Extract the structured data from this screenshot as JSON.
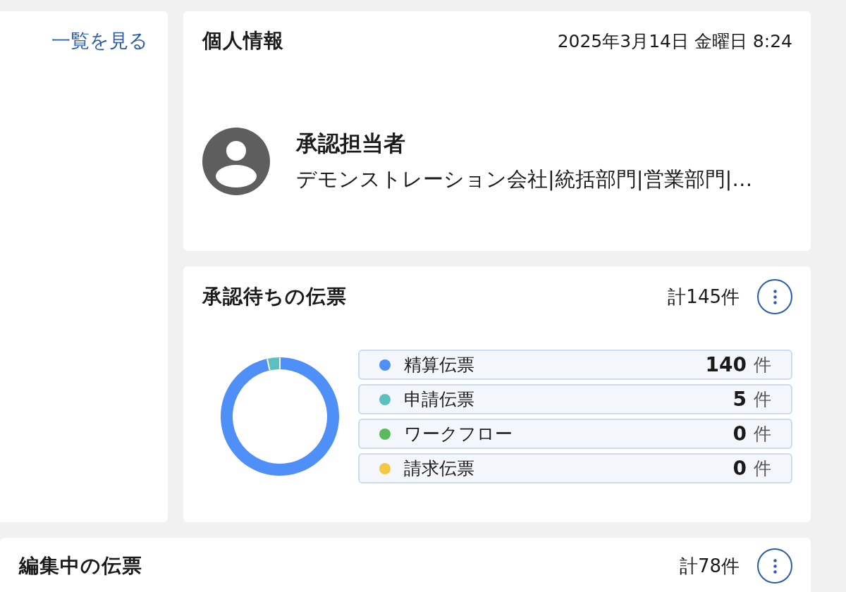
{
  "side_panel": {
    "link": "一覧を見る"
  },
  "profile_card": {
    "title": "個人情報",
    "datetime": "2025年3月14日 金曜日 8:24",
    "user": {
      "name": "承認担当者",
      "organization": "デモンストレーション会社|統括部門|営業部門|…"
    }
  },
  "pending_card": {
    "title": "承認待ちの伝票",
    "total": "計145件",
    "chart_data": {
      "type": "donut",
      "categories": [
        "精算伝票",
        "申請伝票",
        "ワークフロー",
        "請求伝票"
      ],
      "values": [
        96.55,
        3.45,
        0,
        0
      ]
    },
    "legend": [
      {
        "count": "140",
        "unit": "件",
        "color": "#4f8ff8"
      },
      {
        "count": "5",
        "unit": "件",
        "color": "#5cbfc0"
      },
      {
        "count": "0",
        "unit": "件",
        "color": "#5cb85c"
      },
      {
        "count": "0",
        "unit": "件",
        "color": "#f4c842"
      }
    ]
  },
  "editing_card": {
    "title": "編集中の伝票",
    "total": "計78件"
  }
}
